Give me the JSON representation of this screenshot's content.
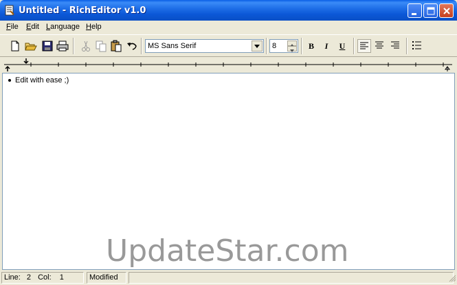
{
  "window": {
    "title": "Untitled - RichEditor v1.0"
  },
  "menu": [
    {
      "label": "File",
      "accel": "F",
      "rest": "ile"
    },
    {
      "label": "Edit",
      "accel": "E",
      "rest": "dit"
    },
    {
      "label": "Language",
      "accel": "L",
      "rest": "anguage"
    },
    {
      "label": "Help",
      "accel": "H",
      "rest": "elp"
    }
  ],
  "toolbar": {
    "icons": [
      "new-icon",
      "open-icon",
      "save-icon",
      "print-icon",
      "cut-icon",
      "copy-icon",
      "paste-icon",
      "undo-icon"
    ],
    "font_name": "MS Sans Serif",
    "font_size": "8",
    "bold": "B",
    "italic": "I",
    "underline": "U",
    "align_icons": [
      "align-left-icon",
      "align-center-icon",
      "align-right-icon"
    ],
    "list_icon": "bullet-list-icon"
  },
  "editor": {
    "line1": "Edit with ease ;)"
  },
  "watermark": "UpdateStar.com",
  "status": {
    "line_label": "Line:",
    "line_value": "2",
    "col_label": "Col:",
    "col_value": "1",
    "state": "Modified"
  },
  "colors": {
    "titlebar": "#0b57d6",
    "window_bg": "#ece9d8",
    "editor_border": "#7f9db9"
  }
}
